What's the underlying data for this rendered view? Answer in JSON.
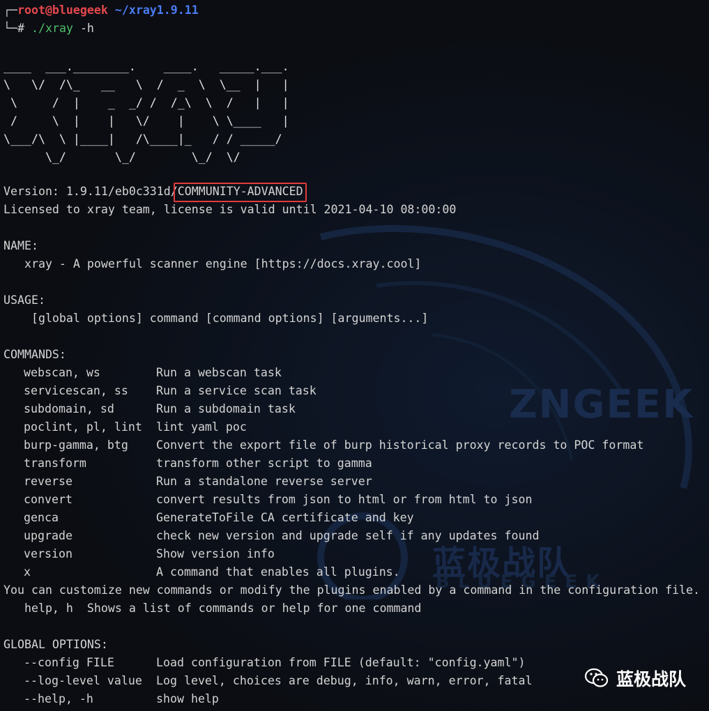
{
  "prompt": {
    "user": "root@bluegeek",
    "path": "~/xray1.9.11",
    "symbol": "#",
    "command": "./xray",
    "args": "-h"
  },
  "ascii_logo": [
    "____  ___.________.    ____.   _____.___.",
    "\\   \\/  /\\_   __   \\  /  _  \\  \\__  |   |",
    " \\     /  |    _  _/ /  /_\\  \\  /   |   |",
    " /     \\  |    |   \\/    |    \\ \\____   |",
    "\\___/\\  \\ |____|   /\\____|_   / / _____/",
    "      \\_/       \\_/        \\_/  \\/"
  ],
  "version_prefix": "Version: 1.9.11/eb0c331d/",
  "version_edition": "COMMUNITY-ADVANCED",
  "license_line": "Licensed to xray team, license is valid until 2021-04-10 08:00:00",
  "name_header": "NAME:",
  "name_value": "   xray - A powerful scanner engine [https://docs.xray.cool]",
  "usage_header": "USAGE:",
  "usage_value": "    [global options] command [command options] [arguments...]",
  "commands_header": "COMMANDS:",
  "commands": [
    {
      "name": "webscan, ws",
      "desc": "Run a webscan task"
    },
    {
      "name": "servicescan, ss",
      "desc": "Run a service scan task"
    },
    {
      "name": "subdomain, sd",
      "desc": "Run a subdomain task"
    },
    {
      "name": "poclint, pl, lint",
      "desc": "lint yaml poc"
    },
    {
      "name": "burp-gamma, btg",
      "desc": "Convert the export file of burp historical proxy records to POC format"
    },
    {
      "name": "transform",
      "desc": "transform other script to gamma"
    },
    {
      "name": "reverse",
      "desc": "Run a standalone reverse server"
    },
    {
      "name": "convert",
      "desc": "convert results from json to html or from html to json"
    },
    {
      "name": "genca",
      "desc": "GenerateToFile CA certificate and key"
    },
    {
      "name": "upgrade",
      "desc": "check new version and upgrade self if any updates found"
    },
    {
      "name": "version",
      "desc": "Show version info"
    },
    {
      "name": "x",
      "desc": "A command that enables all plugins."
    }
  ],
  "customize_line": "You can customize new commands or modify the plugins enabled by a command in the configuration file.",
  "help_line": "   help, h  Shows a list of commands or help for one command",
  "global_header": "GLOBAL OPTIONS:",
  "global_options": [
    {
      "name": "--config FILE",
      "desc": "Load configuration from FILE (default: \"config.yaml\")"
    },
    {
      "name": "--log-level value",
      "desc": "Log level, choices are debug, info, warn, error, fatal"
    },
    {
      "name": "--help, -h",
      "desc": "show help"
    }
  ],
  "watermark": {
    "zngeek": "ZNGEEK",
    "cn": "蓝极战队",
    "en": "BLUEGEEK"
  },
  "brand": {
    "label": "蓝极战队",
    "icon": "wechat-icon"
  },
  "colors": {
    "background": "#0b0d12",
    "user": "#e5484d",
    "path": "#4b7cf3",
    "command": "#4fbf6a",
    "highlight": "#e23b3b"
  }
}
